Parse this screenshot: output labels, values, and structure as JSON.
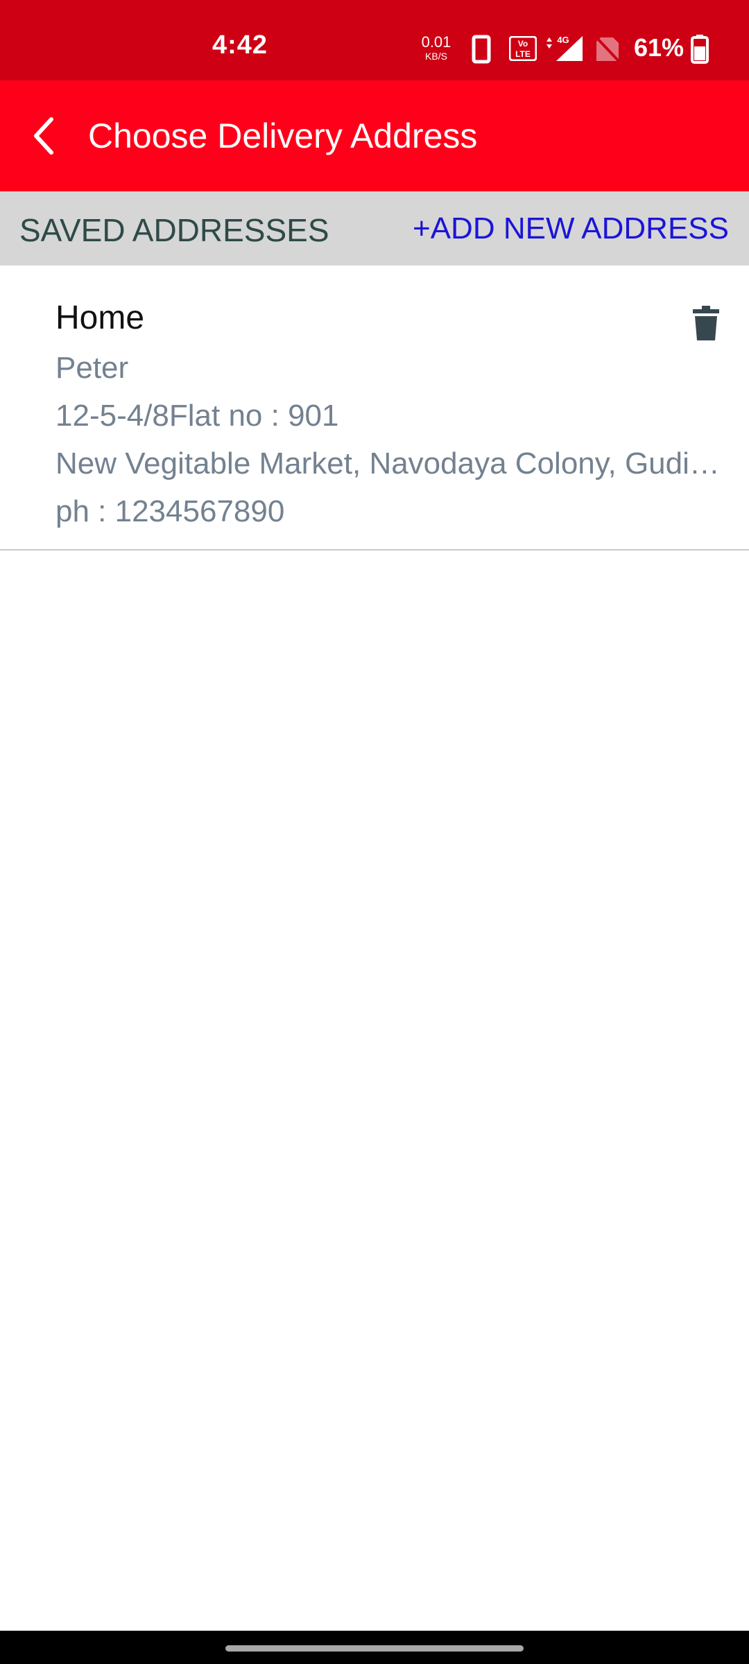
{
  "status_bar": {
    "time": "4:42",
    "net_speed_value": "0.01",
    "net_speed_unit": "KB/S",
    "volte_label": "Vo LTE",
    "network_type": "4G",
    "battery_percent": "61%"
  },
  "app_bar": {
    "title": "Choose Delivery Address",
    "back_icon": "chevron-left-icon"
  },
  "section": {
    "title": "SAVED ADDRESSES",
    "add_button_label": "+ADD NEW ADDRESS"
  },
  "addresses": [
    {
      "label": "Home",
      "name": "Peter",
      "line1": "12-5-4/8Flat no : 901",
      "line2": "New Vegitable Market, Navodaya Colony, Gudimalkapur",
      "phone": "ph : 1234567890",
      "delete_icon": "trash-icon"
    }
  ],
  "colors": {
    "status_bar": "#cd0014",
    "app_bar": "#ff001b",
    "section_bg": "#d6d6d6",
    "section_text": "#2e4a48",
    "link": "#1b14d8",
    "secondary_text": "#738190"
  }
}
